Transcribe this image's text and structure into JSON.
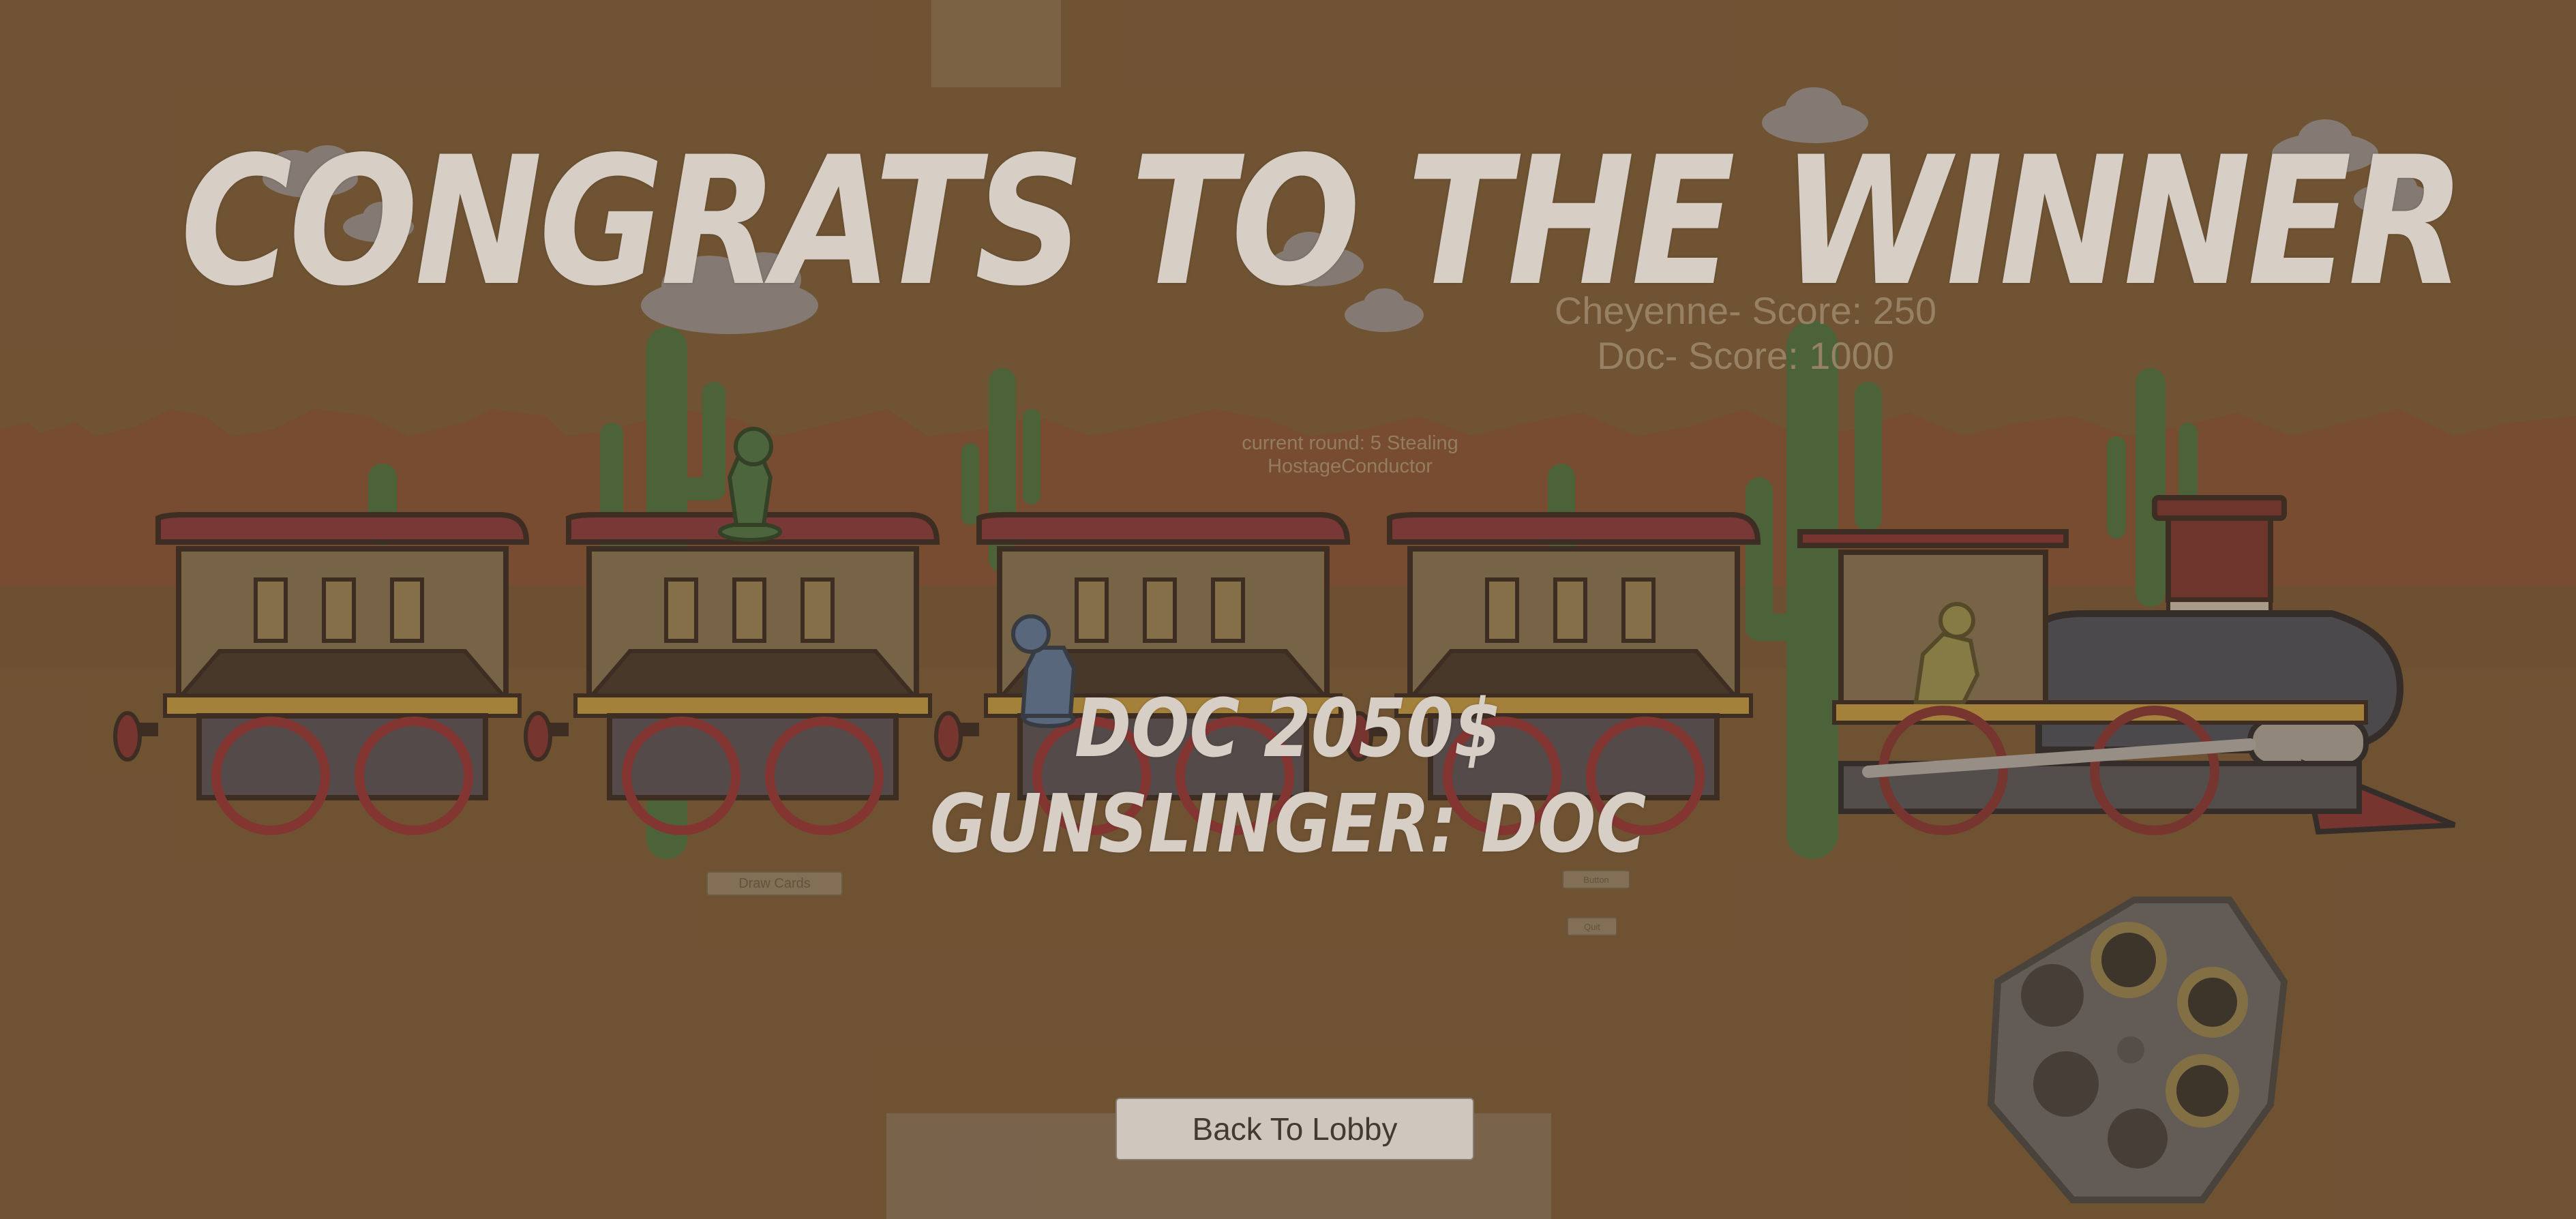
{
  "title": "CONGRATS TO THE WINNER",
  "winner": {
    "money_line": "DOC 2050$",
    "gunslinger_line": "GUNSLINGER: DOC"
  },
  "scores": [
    "Cheyenne- Score: 250",
    "Doc- Score: 1000"
  ],
  "round_info": {
    "line1": "current round: 5 Stealing",
    "line2": "HostageConductor"
  },
  "buttons": {
    "draw_cards": "Draw Cards",
    "button": "Button",
    "quit": "Quit",
    "back_to_lobby": "Back To Lobby"
  },
  "colors": {
    "dimmed_background": "#6e5233",
    "train_roof": "#7a2e38",
    "wheel": "#8b2a33",
    "locomotive_body": "#3e4656",
    "cactus": "#3f6a3c"
  },
  "characters": [
    "cheyenne-figure",
    "doc-figure",
    "conductor-figure"
  ]
}
